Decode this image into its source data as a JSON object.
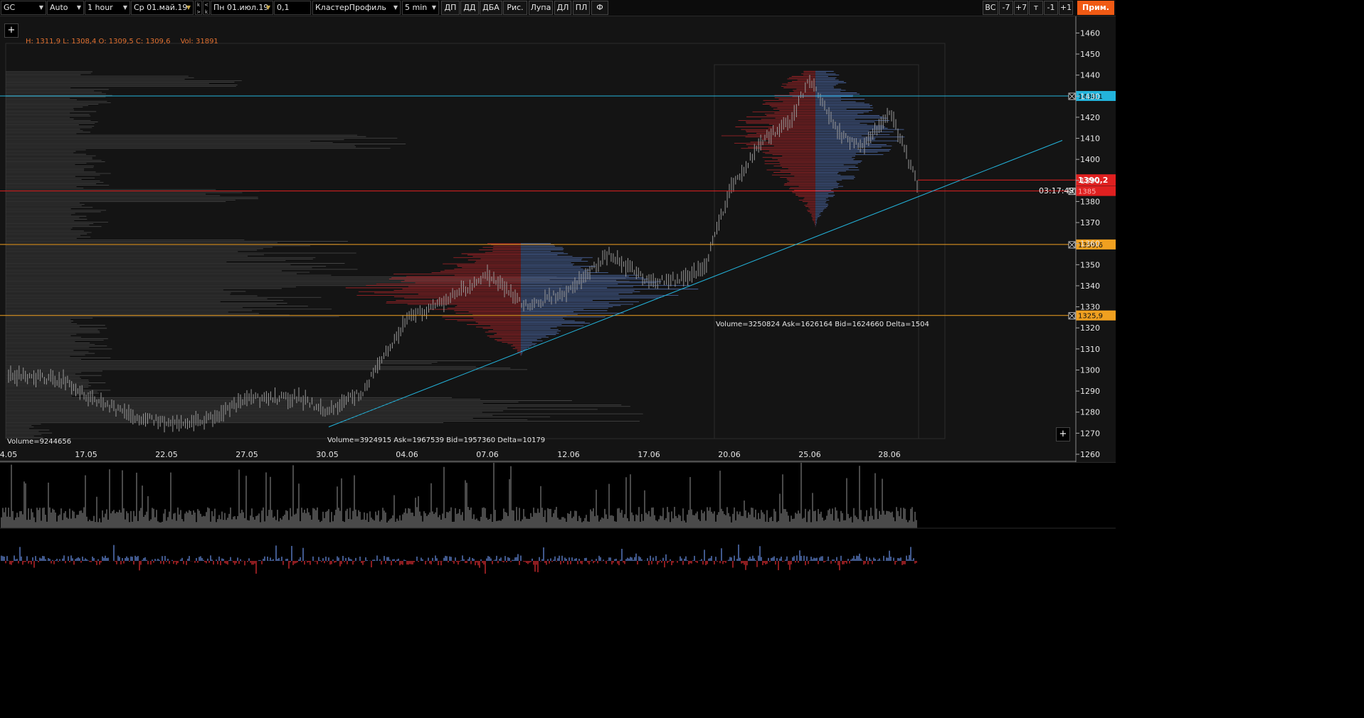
{
  "toolbar": {
    "symbol": "GC",
    "scale_mode": "Auto",
    "timeframe": "1 hour",
    "date_from": "Ср 01.май.19",
    "date_to": "Пн 01.июл.19",
    "tick_size": "0,1",
    "chart_type": "КластерПрофиль",
    "sub_timeframe": "5 min",
    "buttons": [
      "ДП",
      "ДД",
      "ДБА",
      "Рис.",
      "Лупа",
      "ДЛ",
      "ПЛ",
      "Ф"
    ],
    "right_buttons": [
      "ВС",
      "-7",
      "+7",
      "т",
      "-1",
      "+1"
    ],
    "apply_label": "Прим.",
    "stepper_up": "k >",
    "stepper_down": "< k"
  },
  "chart": {
    "ohlc_text": "H: 1311,9  L: 1308,4  O: 1309,5  C: 1309,6",
    "vol_text": "Vol: 31891",
    "timer": "03:17:48",
    "plus_label": "+",
    "profile_labels": [
      "Volume=9244656",
      "Volume=3924915  Ask=1967539  Bid=1957360  Delta=10179",
      "Volume=3250824  Ask=1626164  Bid=1624660  Delta=1504"
    ]
  },
  "colors": {
    "background": "#141414",
    "bid": "#5b7ec9",
    "ask": "#c8282d",
    "line_cyan": "#23b4dc",
    "line_orange": "#f0a020",
    "line_red": "#e02020",
    "price_gray": "#9a9a9a",
    "accent": "#f05a14"
  },
  "chart_data": {
    "type": "candlestick",
    "y_axis": {
      "min": 1260,
      "max": 1465,
      "ticks": [
        1260,
        1270,
        1280,
        1290,
        1300,
        1310,
        1320,
        1330,
        1340,
        1350,
        1360,
        1370,
        1380,
        1390,
        1400,
        1410,
        1420,
        1430,
        1440,
        1450,
        1460
      ]
    },
    "x_ticks": [
      "4.05",
      "17.05",
      "22.05",
      "27.05",
      "30.05",
      "04.06",
      "07.06",
      "12.06",
      "17.06",
      "20.06",
      "25.06",
      "28.06"
    ],
    "price_path": {
      "x": [
        "4.05",
        "14.05",
        "17.05",
        "20.05",
        "22.05",
        "24.05",
        "27.05",
        "29.05",
        "30.05",
        "02.06",
        "04.06",
        "06.06",
        "07.06",
        "10.06",
        "12.06",
        "14.06",
        "17.06",
        "18.06",
        "19.06",
        "20.06",
        "21.06",
        "24.06",
        "25.06",
        "26.06",
        "27.06",
        "28.06",
        "01.07"
      ],
      "y": [
        1298,
        1295,
        1288,
        1279,
        1275,
        1276,
        1286,
        1287,
        1280,
        1290,
        1324,
        1334,
        1345,
        1330,
        1338,
        1355,
        1342,
        1343,
        1348,
        1385,
        1410,
        1418,
        1438,
        1412,
        1405,
        1423,
        1386
      ]
    },
    "horizontal_lines": [
      {
        "label": "1430,1",
        "price": 1430.1,
        "color": "cyan"
      },
      {
        "label": "1385",
        "price": 1385.0,
        "color": "red"
      },
      {
        "label": "1359,6",
        "price": 1359.6,
        "color": "orange"
      },
      {
        "label": "1325,9",
        "price": 1325.9,
        "color": "orange"
      }
    ],
    "current_price": {
      "label": "1390,2",
      "price": 1390.2
    },
    "trendline": {
      "from": {
        "x": "30.05",
        "price": 1273
      },
      "to": {
        "x": "01.07",
        "price": 1409
      }
    },
    "profiles": [
      {
        "name": "Volume=9244656",
        "volume": 9244656
      },
      {
        "name": "Volume=3924915",
        "volume": 3924915,
        "ask": 1967539,
        "bid": 1957360,
        "delta": 10179
      },
      {
        "name": "Volume=3250824",
        "volume": 3250824,
        "ask": 1626164,
        "bid": 1624660,
        "delta": 1504
      }
    ]
  }
}
